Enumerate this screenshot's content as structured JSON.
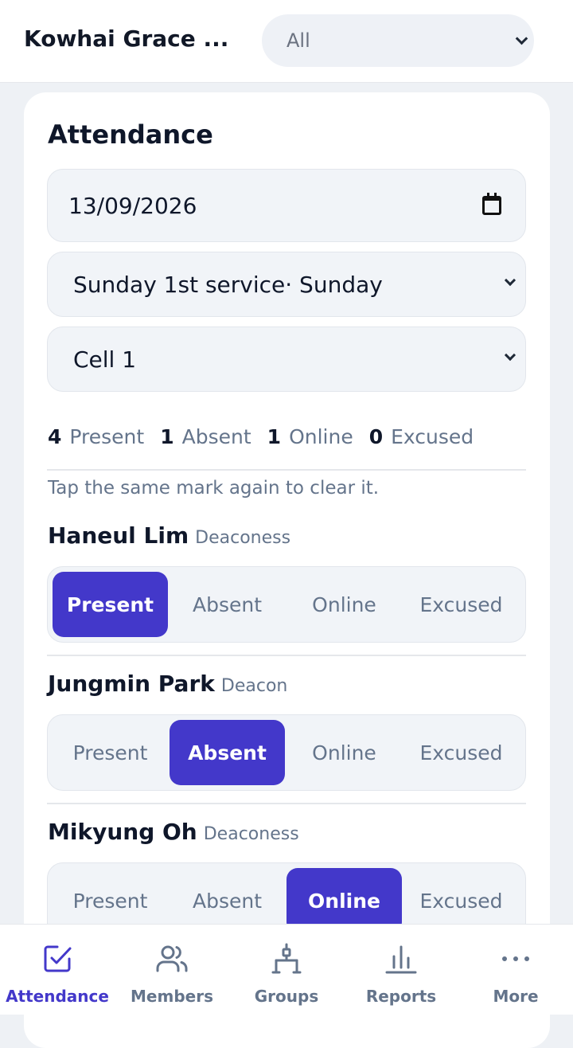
{
  "header": {
    "org_name": "Kowhai Grace ...",
    "scope_value": "All"
  },
  "attendance": {
    "title": "Attendance",
    "date_value": "13/09/2026",
    "service_value": "Sunday 1st service· Sunday",
    "group_value": "Cell 1",
    "summary": {
      "present_count": "4",
      "present_label": "Present",
      "absent_count": "1",
      "absent_label": "Absent",
      "online_count": "1",
      "online_label": "Online",
      "excused_count": "0",
      "excused_label": "Excused"
    },
    "hint": "Tap the same mark again to clear it.",
    "mark_options": [
      "Present",
      "Absent",
      "Online",
      "Excused"
    ],
    "members": [
      {
        "name": "Haneul Lim",
        "role": "Deaconess",
        "selected": "Present"
      },
      {
        "name": "Jungmin Park",
        "role": "Deacon",
        "selected": "Absent"
      },
      {
        "name": "Mikyung Oh",
        "role": "Deaconess",
        "selected": "Online"
      }
    ]
  },
  "nav": {
    "items": [
      {
        "label": "Attendance",
        "icon": "check-square-icon",
        "active": true
      },
      {
        "label": "Members",
        "icon": "users-icon",
        "active": false
      },
      {
        "label": "Groups",
        "icon": "groups-icon",
        "active": false
      },
      {
        "label": "Reports",
        "icon": "bar-chart-icon",
        "active": false
      },
      {
        "label": "More",
        "icon": "more-dots-icon",
        "active": false
      }
    ]
  },
  "colors": {
    "accent": "#4338ca",
    "muted_text": "#64748b",
    "field_bg": "#f1f4f8"
  }
}
